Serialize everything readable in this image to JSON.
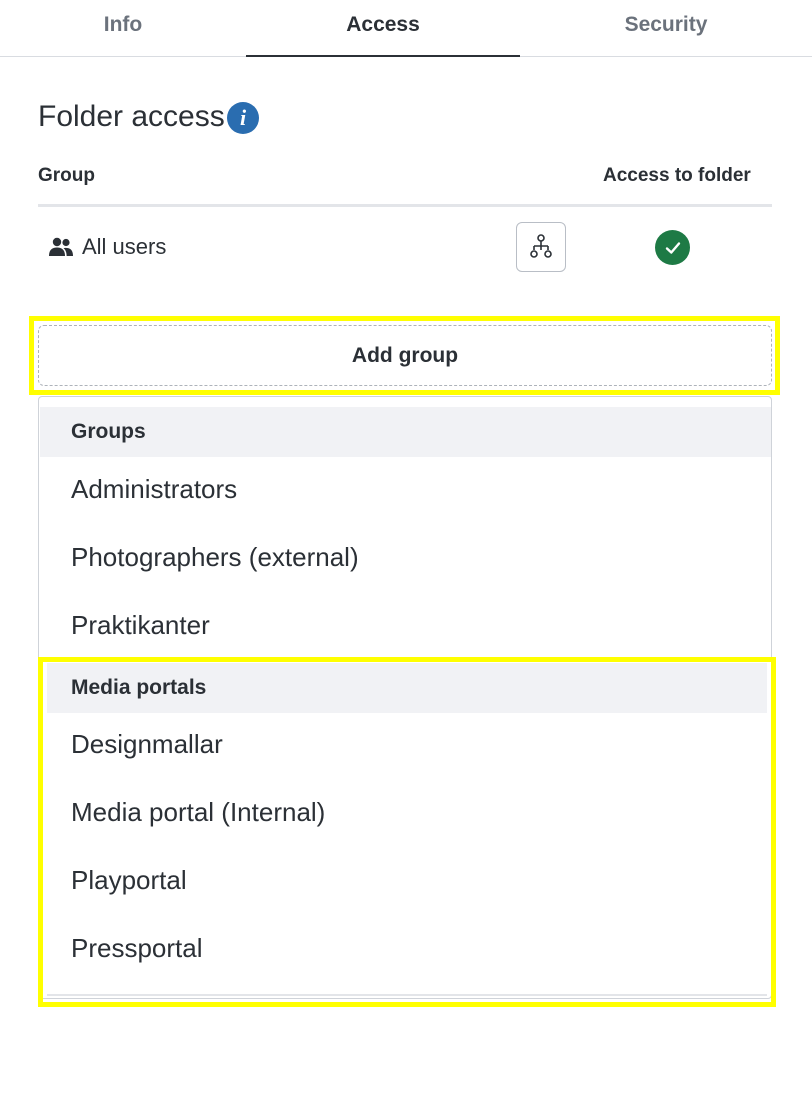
{
  "tabs": [
    {
      "label": "Info",
      "active": false
    },
    {
      "label": "Access",
      "active": true
    },
    {
      "label": "Security",
      "active": false
    }
  ],
  "header": {
    "title": "Folder access",
    "info_icon": "info-icon"
  },
  "table": {
    "columns": [
      "Group",
      "Access to folder"
    ],
    "rows": [
      {
        "label": "All users",
        "icon": "users-icon",
        "action_icon": "hierarchy-icon",
        "access": "check-icon"
      }
    ]
  },
  "add_group": {
    "label": "Add group"
  },
  "dropdown": {
    "sections": [
      {
        "heading": "Groups",
        "items": [
          "Administrators",
          "Photographers (external)",
          "Praktikanter"
        ]
      },
      {
        "heading": "Media portals",
        "items": [
          "Designmallar",
          "Media portal (Internal)",
          "Playportal",
          "Pressportal"
        ]
      }
    ]
  },
  "colors": {
    "accent": "#2a6db0",
    "success": "#1e7a45",
    "highlight": "#ffff00",
    "text": "#2b3036"
  }
}
